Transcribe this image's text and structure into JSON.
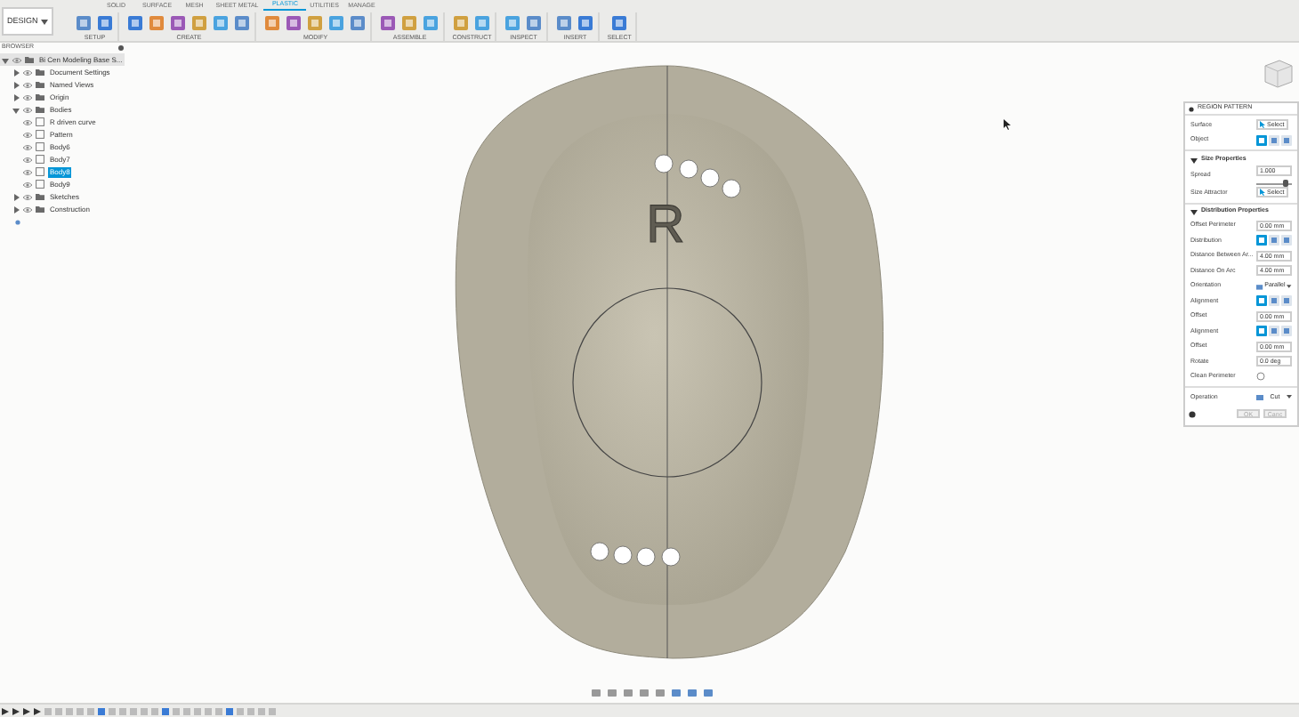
{
  "toolbar": {
    "workspace": "DESIGN",
    "tabs": [
      {
        "label": "SOLID",
        "selected": false
      },
      {
        "label": "SURFACE",
        "selected": false
      },
      {
        "label": "MESH",
        "selected": false
      },
      {
        "label": "SHEET METAL",
        "selected": false
      },
      {
        "label": "PLASTIC",
        "selected": true
      },
      {
        "label": "UTILITIES",
        "selected": false
      },
      {
        "label": "MANAGE",
        "selected": false
      }
    ],
    "groups": [
      "SETUP",
      "CREATE",
      "MODIFY",
      "ASSEMBLE",
      "CONSTRUCT",
      "INSPECT",
      "INSERT",
      "SELECT"
    ]
  },
  "browser": {
    "title": "BROWSER",
    "items": [
      {
        "label": "Bi Cen Modeling Base S...",
        "selected": false,
        "expanded": true,
        "children": [
          {
            "label": "Document Settings",
            "selected": false,
            "expanded": false
          },
          {
            "label": "Named Views",
            "selected": false,
            "expanded": false
          },
          {
            "label": "Origin",
            "selected": false,
            "expanded": false
          },
          {
            "label": "Bodies",
            "selected": false,
            "expanded": true,
            "children": [
              {
                "label": "R driven curve",
                "selected": false
              },
              {
                "label": "Pattern",
                "selected": false
              },
              {
                "label": "Body6",
                "selected": false
              },
              {
                "label": "Body7",
                "selected": false
              },
              {
                "label": "Body8",
                "selected": true
              },
              {
                "label": "Body9",
                "selected": false
              }
            ]
          },
          {
            "label": "Sketches",
            "selected": false,
            "expanded": false
          },
          {
            "label": "Construction",
            "selected": false,
            "expanded": false
          }
        ]
      }
    ]
  },
  "model": {
    "emboss_text": "R"
  },
  "panel": {
    "title": "REGION PATTERN",
    "sections": [
      {
        "rows": [
          {
            "kind": "select",
            "label": "Surface",
            "value": "Select"
          },
          {
            "kind": "icons",
            "label": "Object"
          }
        ]
      },
      {
        "title": "Size Properties",
        "expanded": true,
        "rows": [
          {
            "kind": "slider",
            "label": "Spread",
            "value": "1.000",
            "level": 0.9
          },
          {
            "kind": "select",
            "label": "Size Attractor",
            "value": "Select"
          }
        ]
      },
      {
        "title": "Distribution Properties",
        "expanded": true,
        "rows": [
          {
            "kind": "value",
            "label": "Offset Perimeter",
            "value": "0.00 mm"
          },
          {
            "kind": "icons",
            "label": "Distribution"
          },
          {
            "kind": "value",
            "label": "Distance Between Ar...",
            "value": "4.00 mm"
          },
          {
            "kind": "value",
            "label": "Distance On Arc",
            "value": "4.00 mm"
          },
          {
            "kind": "dropdown",
            "label": "Orientation",
            "value": "Parallel"
          },
          {
            "kind": "icons",
            "label": "Alignment"
          },
          {
            "kind": "value",
            "label": "Offset",
            "value": "0.00 mm"
          },
          {
            "kind": "icons",
            "label": "Alignment"
          },
          {
            "kind": "value",
            "label": "Offset",
            "value": "0.00 mm"
          },
          {
            "kind": "value",
            "label": "Rotate",
            "value": "0.0 deg"
          },
          {
            "kind": "toggle",
            "label": "Clean Perimeter"
          }
        ]
      },
      {
        "rows": [
          {
            "kind": "dropdown",
            "label": "Operation",
            "value": "Cut"
          }
        ]
      }
    ],
    "buttons": [
      "OK",
      "Canc"
    ]
  }
}
